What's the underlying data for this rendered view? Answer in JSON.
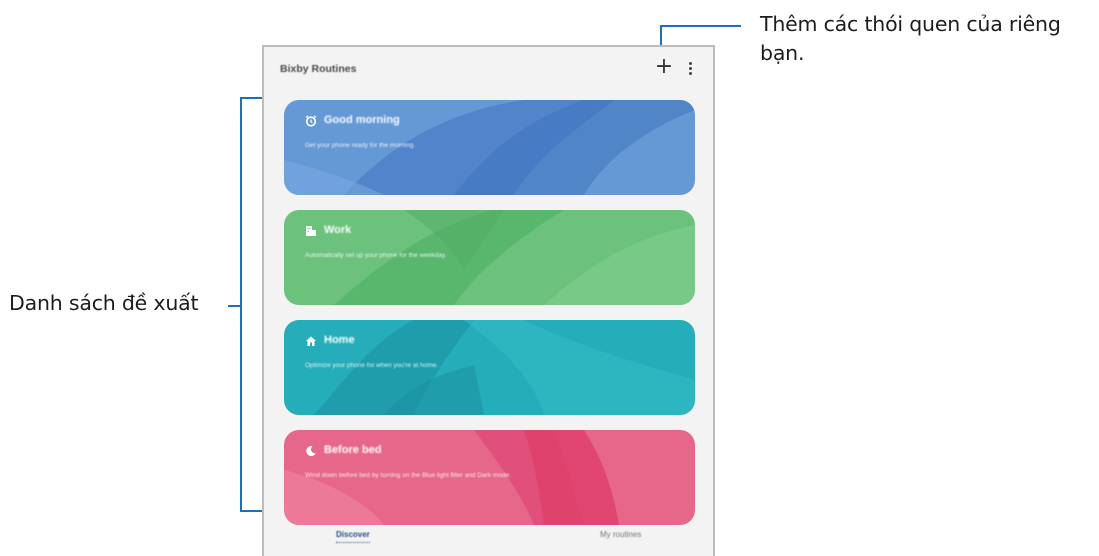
{
  "annotations": {
    "add_routine": "Thêm các thói quen của riêng bạn.",
    "suggested_list": "Danh sách đề xuất"
  },
  "app": {
    "title": "Bixby Routines",
    "add_icon": "plus-icon",
    "more_icon": "more-vert-icon"
  },
  "cards": [
    {
      "title": "Good morning",
      "description": "Get your phone ready for the morning.",
      "icon": "alarm-icon",
      "color": "#5a8fd4"
    },
    {
      "title": "Work",
      "description": "Automatically set up your phone for the weekday.",
      "icon": "building-icon",
      "color": "#69c07a"
    },
    {
      "title": "Home",
      "description": "Optimize your phone for when you're at home.",
      "icon": "home-icon",
      "color": "#2ab1bc"
    },
    {
      "title": "Before bed",
      "description": "Wind down before bed by turning on the Blue light filter and Dark mode.",
      "icon": "moon-icon",
      "color": "#e66585"
    }
  ],
  "tabs": {
    "discover": "Discover",
    "my_routines": "My routines"
  },
  "colors": {
    "callout_line": "#1f6fb2",
    "screen_bg": "#f3f3f3"
  }
}
